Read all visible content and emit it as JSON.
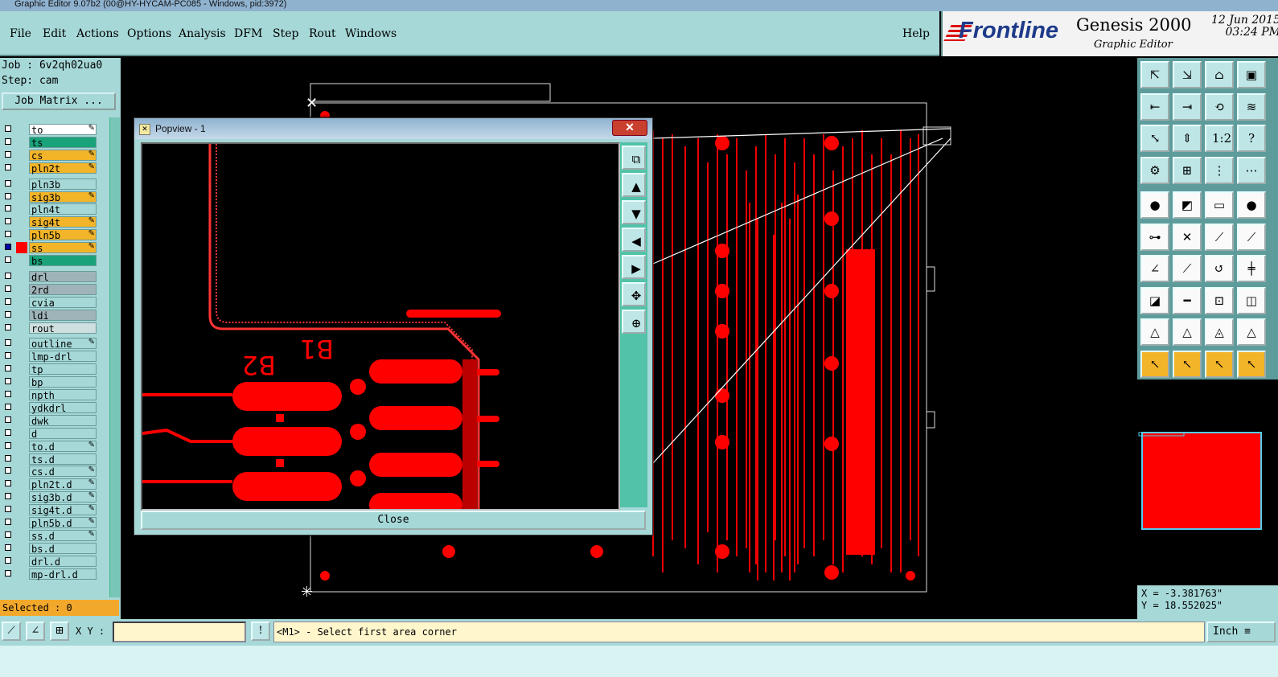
{
  "window": {
    "title": "Graphic Editor 9.07b2 (00@HY-HYCAM-PC085 - Windows, pid:3972)"
  },
  "menu": {
    "items": [
      "File",
      "Edit",
      "Actions",
      "Options",
      "Analysis",
      "DFM",
      "Step",
      "Rout",
      "Windows"
    ],
    "help": "Help"
  },
  "brand": {
    "logo": "Frontline",
    "product": "Genesis 2000",
    "subtitle": "Graphic Editor",
    "date": "12 Jun 2015",
    "time": "03:24 PM"
  },
  "job": {
    "job_line": "Job : 6v2qh02ua0",
    "step_line": "Step: cam",
    "matrix_button": "Job Matrix ..."
  },
  "layers": [
    {
      "name": "to",
      "color": "#ffffff",
      "edit": true
    },
    {
      "name": "ts",
      "color": "#1aa37a",
      "edit": false
    },
    {
      "name": "cs",
      "color": "#f2b429",
      "edit": true
    },
    {
      "name": "pln2t",
      "color": "#f2b429",
      "edit": true
    },
    {
      "name": "pln3b",
      "color": "#a6d8d8",
      "edit": false
    },
    {
      "name": "sig3b",
      "color": "#f2b429",
      "edit": true
    },
    {
      "name": "pln4t",
      "color": "#a6d8d8",
      "edit": false
    },
    {
      "name": "sig4t",
      "color": "#f2b429",
      "edit": true
    },
    {
      "name": "pln5b",
      "color": "#f2b429",
      "edit": true
    },
    {
      "name": "ss",
      "color": "#f2b429",
      "edit": true,
      "active": true
    },
    {
      "name": "bs",
      "color": "#1aa37a",
      "edit": false
    },
    {
      "name": "drl",
      "color": "#9fb4b8",
      "edit": false
    },
    {
      "name": "2rd",
      "color": "#9fb4b8",
      "edit": false
    },
    {
      "name": "cvia",
      "color": "#a6d8d8",
      "edit": false
    },
    {
      "name": "ldi",
      "color": "#9fb4b8",
      "edit": false
    },
    {
      "name": "rout",
      "color": "#cfdfe0",
      "edit": false
    },
    {
      "name": "outline",
      "color": "#a6d8d8",
      "edit": true
    },
    {
      "name": "lmp-drl",
      "color": "#a6d8d8",
      "edit": false
    },
    {
      "name": "tp",
      "color": "#a6d8d8",
      "edit": false
    },
    {
      "name": "bp",
      "color": "#a6d8d8",
      "edit": false
    },
    {
      "name": "npth",
      "color": "#a6d8d8",
      "edit": false
    },
    {
      "name": "ydkdrl",
      "color": "#a6d8d8",
      "edit": false
    },
    {
      "name": "dwk",
      "color": "#a6d8d8",
      "edit": false
    },
    {
      "name": "d",
      "color": "#a6d8d8",
      "edit": false
    },
    {
      "name": "to.d",
      "color": "#a6d8d8",
      "edit": true
    },
    {
      "name": "ts.d",
      "color": "#a6d8d8",
      "edit": false
    },
    {
      "name": "cs.d",
      "color": "#a6d8d8",
      "edit": true
    },
    {
      "name": "pln2t.d",
      "color": "#a6d8d8",
      "edit": true
    },
    {
      "name": "sig3b.d",
      "color": "#a6d8d8",
      "edit": true
    },
    {
      "name": "sig4t.d",
      "color": "#a6d8d8",
      "edit": true
    },
    {
      "name": "pln5b.d",
      "color": "#a6d8d8",
      "edit": true
    },
    {
      "name": "ss.d",
      "color": "#a6d8d8",
      "edit": true
    },
    {
      "name": "bs.d",
      "color": "#a6d8d8",
      "edit": false
    },
    {
      "name": "drl.d",
      "color": "#a6d8d8",
      "edit": false
    },
    {
      "name": "mp-drl.d",
      "color": "#a6d8d8",
      "edit": false
    }
  ],
  "selected": "Selected : 0",
  "popview": {
    "title": "Popview - 1",
    "close_button": "Close",
    "close_x": "✕",
    "labels": [
      "B2",
      "B1"
    ]
  },
  "coords": {
    "x": "X = -3.381763\"",
    "y": "Y = 18.552025\""
  },
  "bottom": {
    "xy_label": "X Y :",
    "xy_value": "",
    "prompt": "<M1> - Select first area corner",
    "unit": "Inch"
  },
  "colors": {
    "panel": "#a6d8d8",
    "trace": "#ff0000",
    "accent": "#f2b429"
  }
}
